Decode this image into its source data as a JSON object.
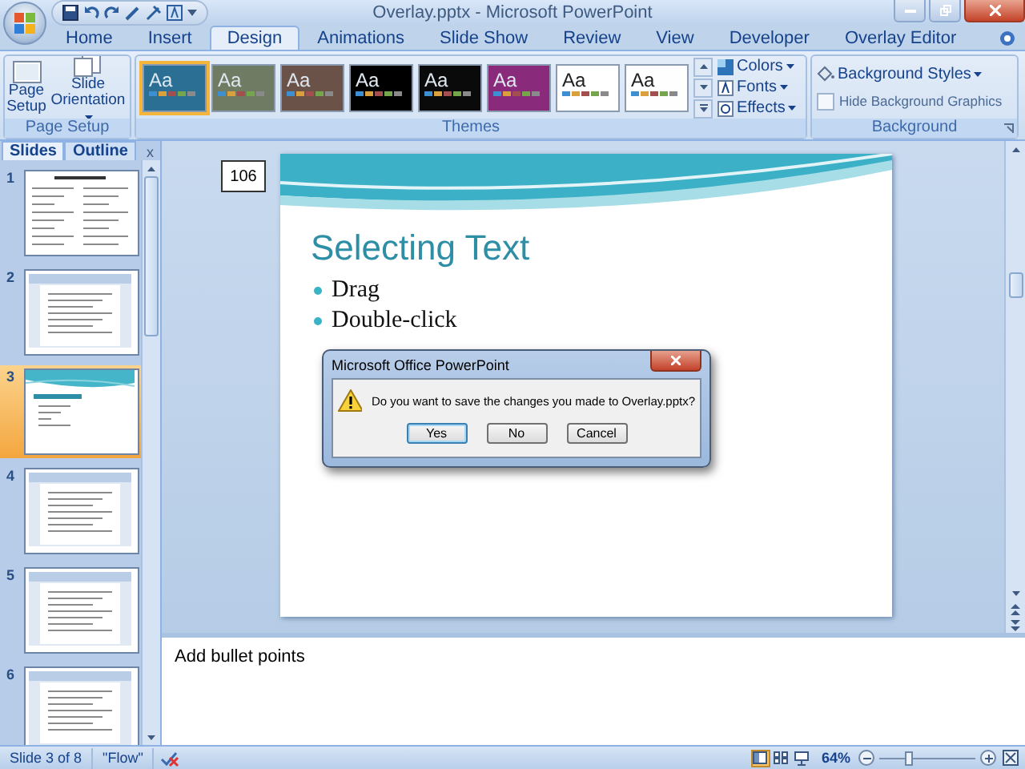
{
  "window": {
    "title": "Overlay.pptx - Microsoft PowerPoint"
  },
  "ribbon_tabs": [
    {
      "label": "Home",
      "selected": false
    },
    {
      "label": "Insert",
      "selected": false
    },
    {
      "label": "Design",
      "selected": true
    },
    {
      "label": "Animations",
      "selected": false
    },
    {
      "label": "Slide Show",
      "selected": false
    },
    {
      "label": "Review",
      "selected": false
    },
    {
      "label": "View",
      "selected": false
    },
    {
      "label": "Developer",
      "selected": false
    },
    {
      "label": "Overlay Editor",
      "selected": false
    }
  ],
  "page_setup": {
    "buttons": [
      "Page Setup",
      "Slide Orientation"
    ],
    "label": "Page Setup"
  },
  "themes": {
    "label": "Themes",
    "items": [
      {
        "label": "Aa",
        "color": "#2b6f95",
        "selected": true
      },
      {
        "label": "Aa",
        "color": "#6f7b62",
        "selected": false
      },
      {
        "label": "Aa",
        "color": "#6b5248",
        "selected": false
      },
      {
        "label": "Aa",
        "color": "#000000",
        "selected": false
      },
      {
        "label": "Aa",
        "color": "#0a0a0a",
        "selected": false
      },
      {
        "label": "Aa",
        "color": "#8a2a7a",
        "selected": false
      },
      {
        "label": "Aa",
        "color": "#ffffff",
        "selected": false
      },
      {
        "label": "Aa",
        "color": "#fefefe",
        "selected": false
      }
    ],
    "options": [
      "Colors",
      "Fonts",
      "Effects"
    ]
  },
  "background": {
    "label": "Background",
    "styles": "Background Styles",
    "hide_graphics": {
      "label": "Hide Background Graphics",
      "checked": false
    }
  },
  "panel": {
    "tabs": [
      {
        "label": "Slides",
        "selected": true
      },
      {
        "label": "Outline",
        "selected": false
      }
    ],
    "close": "x",
    "slides": [
      {
        "number": "1",
        "kind": "columns",
        "selected": false
      },
      {
        "number": "2",
        "kind": "screenshot",
        "selected": false
      },
      {
        "number": "3",
        "kind": "themed",
        "selected": true
      },
      {
        "number": "4",
        "kind": "screenshot",
        "selected": false
      },
      {
        "number": "5",
        "kind": "screenshot",
        "selected": false
      },
      {
        "number": "6",
        "kind": "screenshot",
        "selected": false
      }
    ]
  },
  "slide": {
    "number_tag": "106",
    "title": "Selecting Text",
    "bullets": [
      "Drag",
      "Double-click"
    ]
  },
  "dialog": {
    "title": "Microsoft Office PowerPoint",
    "message": "Do you want to save the changes you made to Overlay.pptx?",
    "buttons": [
      {
        "label": "Yes",
        "selected": true
      },
      {
        "label": "No",
        "selected": false
      },
      {
        "label": "Cancel",
        "selected": false
      }
    ]
  },
  "notes": {
    "text": "Add bullet points"
  },
  "status_bar": {
    "slide": "Slide 3 of 8",
    "theme": "\"Flow\"",
    "views": [
      {
        "kind": "normal",
        "selected": true
      },
      {
        "kind": "sorter",
        "selected": false
      },
      {
        "kind": "show",
        "selected": false
      }
    ],
    "zoom": "64%",
    "zoom_slider": {
      "level": 0.3
    }
  }
}
